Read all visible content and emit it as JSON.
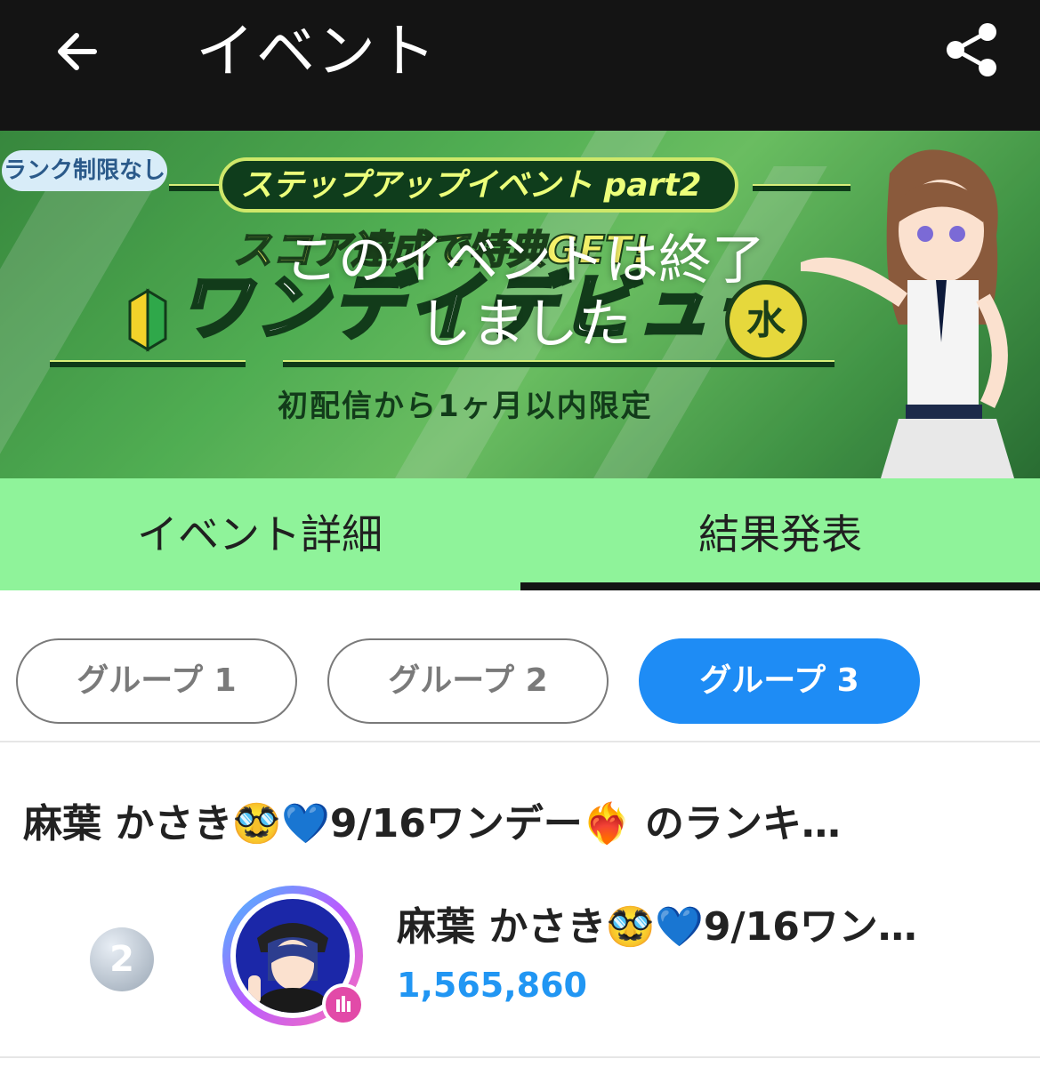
{
  "appbar": {
    "title": "イベント",
    "back_icon": "arrow-left-icon",
    "share_icon": "share-icon"
  },
  "banner": {
    "rank_badge": "ランク制限なし",
    "step_label": "ステップアップイベント part2",
    "score_label": "スコア達成で特典GET!",
    "event_name": "ワンデイデビュー",
    "day_badge": "水",
    "limit_label": "初配信から1ヶ月以内限定",
    "overlay_message": "このイベントは終了しました"
  },
  "tabs": [
    {
      "label": "イベント詳細",
      "selected": false
    },
    {
      "label": "結果発表",
      "selected": true
    }
  ],
  "groups": [
    {
      "label": "グループ 1",
      "selected": false
    },
    {
      "label": "グループ 2",
      "selected": false
    },
    {
      "label": "グループ 3",
      "selected": true
    }
  ],
  "colors": {
    "accent": "#1e8cf5",
    "tab_bg": "#8ff39a",
    "appbar": "#141414",
    "score": "#2196f3"
  },
  "ranking": {
    "title": "麻葉 かさき🥸💙9/16ワンデー❤️‍🔥 のランキ…",
    "rows": [
      {
        "rank": "2",
        "name": "麻葉 かさき🥸💙9/16ワン…",
        "score": "1,565,860",
        "live_icon": "live-bars-icon"
      }
    ]
  }
}
